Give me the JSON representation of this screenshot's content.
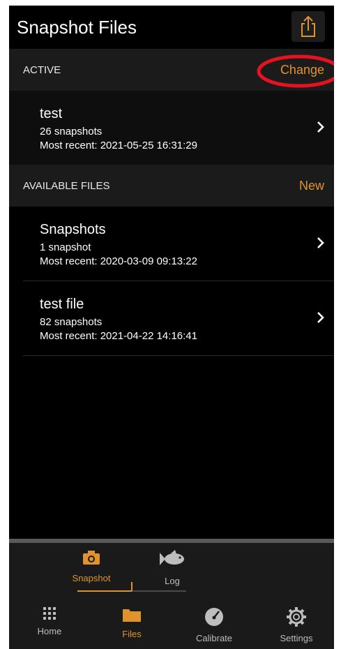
{
  "header": {
    "title": "Snapshot Files"
  },
  "active": {
    "label": "ACTIVE",
    "action": "Change",
    "file": {
      "name": "test",
      "count": "26 snapshots",
      "recent": "Most recent: 2021-05-25 16:31:29"
    }
  },
  "available": {
    "label": "AVAILABLE FILES",
    "action": "New",
    "files": [
      {
        "name": "Snapshots",
        "count": "1 snapshot",
        "recent": "Most recent: 2020-03-09 09:13:22"
      },
      {
        "name": "test file",
        "count": "82 snapshots",
        "recent": "Most recent: 2021-04-22 14:16:41"
      }
    ]
  },
  "subtabs": [
    {
      "label": "Snapshot",
      "icon": "camera-icon",
      "selected": true
    },
    {
      "label": "Log",
      "icon": "fish-icon",
      "selected": false
    }
  ],
  "tabs": [
    {
      "label": "Home",
      "icon": "grid-icon"
    },
    {
      "label": "Files",
      "icon": "folder-icon"
    },
    {
      "label": "Calibrate",
      "icon": "gauge-icon"
    },
    {
      "label": "Settings",
      "icon": "gear-icon"
    }
  ],
  "colors": {
    "accent": "#e0932c",
    "background": "#000000",
    "annotation": "#e5121f"
  }
}
